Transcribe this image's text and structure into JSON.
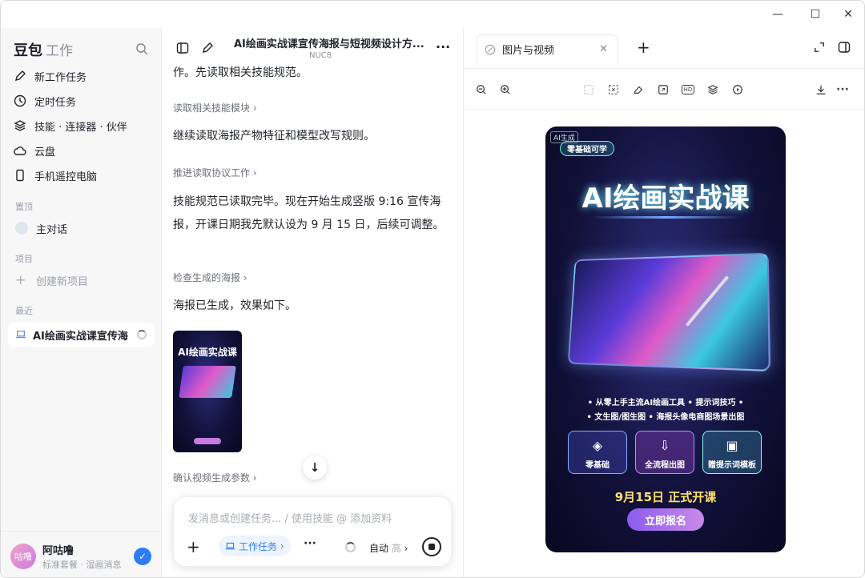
{
  "window": {
    "min": "—",
    "max": "☐",
    "close": "✕"
  },
  "sidebar": {
    "brand": "豆包",
    "brand_sub": "工作",
    "items": [
      {
        "label": "新工作任务"
      },
      {
        "label": "定时任务"
      },
      {
        "label": "技能 · 连接器 · 伙伴"
      },
      {
        "label": "云盘"
      },
      {
        "label": "手机遥控电脑"
      }
    ],
    "pinned_title": "置顶",
    "pinned": "主对话",
    "projects_title": "项目",
    "new_project": "创建新项目",
    "recent_title": "最近",
    "recent_item": "AI绘画实战课宣传海",
    "user": {
      "name": "阿咕噜",
      "plan": "标准套餐 · 湿画消息",
      "avatar_text": "咕噜"
    }
  },
  "chat": {
    "title": "AI绘画实战课宣传海报与短视频设计方...",
    "device": "NUC8",
    "messages": [
      {
        "text": "作。先读取相关技能规范。"
      },
      {
        "step": "读取相关技能模块"
      },
      {
        "text": "继续读取海报产物特征和模型改写规则。"
      },
      {
        "step": "推进读取协议工作"
      },
      {
        "text": "技能规范已读取完毕。现在开始生成竖版 9:16 宣传海报，开课日期我先默认设为 9 月 15 日，后续可调整。"
      },
      {
        "step": "检查生成的海报"
      },
      {
        "text": "海报已生成，效果如下。"
      },
      {
        "step": "确认视频生成参数"
      }
    ],
    "input_placeholder": "发消息或创建任务... / 使用技能 @ 添加资料",
    "work_task": "工作任务",
    "mode": "自动",
    "mode_sub": "高"
  },
  "viewer": {
    "tab_label": "图片与视频",
    "poster": {
      "ai_badge": "AI生成",
      "tag": "零基础可学",
      "title": "AI绘画实战课",
      "bullet1": "• 从零上手主流AI绘画工具 • 提示词技巧 •",
      "bullet2": "• 文生图/图生图 • 海报头像电商图场景出图",
      "features": [
        "零基础",
        "全流程出图",
        "赠提示词模板"
      ],
      "date": "9月15日  正式开课",
      "cta": "立即报名"
    }
  }
}
